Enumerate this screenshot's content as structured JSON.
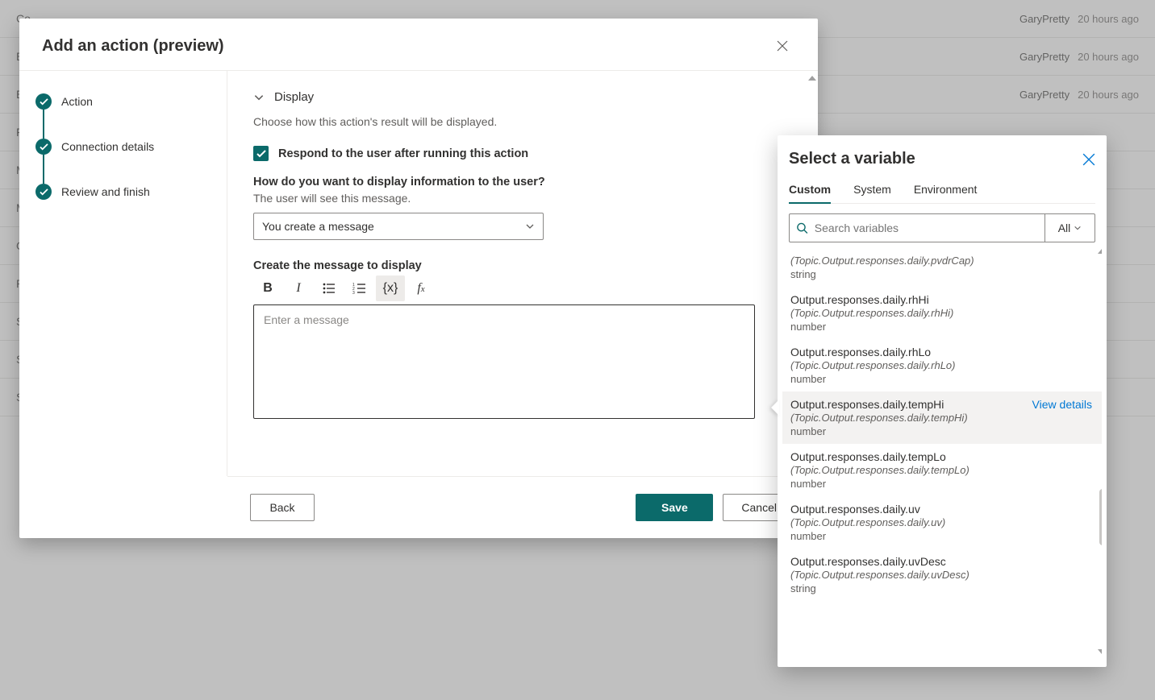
{
  "backgroundRows": [
    {
      "label": "Co",
      "author": "GaryPretty",
      "time": "20 hours ago"
    },
    {
      "label": "En",
      "author": "GaryPretty",
      "time": "20 hours ago"
    },
    {
      "label": "Esc",
      "author": "GaryPretty",
      "time": "20 hours ago"
    },
    {
      "label": "Fall",
      "author": "",
      "time": ""
    },
    {
      "label": "MS",
      "author": "",
      "time": ""
    },
    {
      "label": "Mu",
      "author": "",
      "time": ""
    },
    {
      "label": "On",
      "author": "",
      "time": ""
    },
    {
      "label": "Re",
      "author": "",
      "time": ""
    },
    {
      "label": "Sig",
      "author": "",
      "time": ""
    },
    {
      "label": "Sto",
      "author": "",
      "time": ""
    },
    {
      "label": "Sto",
      "author": "",
      "time": ""
    }
  ],
  "modal": {
    "title": "Add an action (preview)",
    "steps": [
      {
        "label": "Action"
      },
      {
        "label": "Connection details"
      },
      {
        "label": "Review and finish"
      }
    ],
    "section": {
      "title": "Display",
      "description": "Choose how this action's result will be displayed.",
      "checkboxLabel": "Respond to the user after running this action",
      "displayQuestion": "How do you want to display information to the user?",
      "displaySub": "The user will see this message.",
      "dropdownValue": "You create a message",
      "createLabel": "Create the message to display",
      "editorPlaceholder": "Enter a message"
    },
    "footer": {
      "back": "Back",
      "save": "Save",
      "cancel": "Cancel"
    }
  },
  "popover": {
    "title": "Select a variable",
    "tabs": {
      "custom": "Custom",
      "system": "System",
      "environment": "Environment"
    },
    "searchPlaceholder": "Search variables",
    "filterLabel": "All",
    "viewDetails": "View details",
    "variables": [
      {
        "name": "",
        "path": "(Topic.Output.responses.daily.pvdrCap)",
        "type": "string",
        "truncatedTop": true
      },
      {
        "name": "Output.responses.daily.rhHi",
        "path": "(Topic.Output.responses.daily.rhHi)",
        "type": "number"
      },
      {
        "name": "Output.responses.daily.rhLo",
        "path": "(Topic.Output.responses.daily.rhLo)",
        "type": "number"
      },
      {
        "name": "Output.responses.daily.tempHi",
        "path": "(Topic.Output.responses.daily.tempHi)",
        "type": "number",
        "hovered": true
      },
      {
        "name": "Output.responses.daily.tempLo",
        "path": "(Topic.Output.responses.daily.tempLo)",
        "type": "number"
      },
      {
        "name": "Output.responses.daily.uv",
        "path": "(Topic.Output.responses.daily.uv)",
        "type": "number"
      },
      {
        "name": "Output.responses.daily.uvDesc",
        "path": "(Topic.Output.responses.daily.uvDesc)",
        "type": "string"
      }
    ]
  }
}
